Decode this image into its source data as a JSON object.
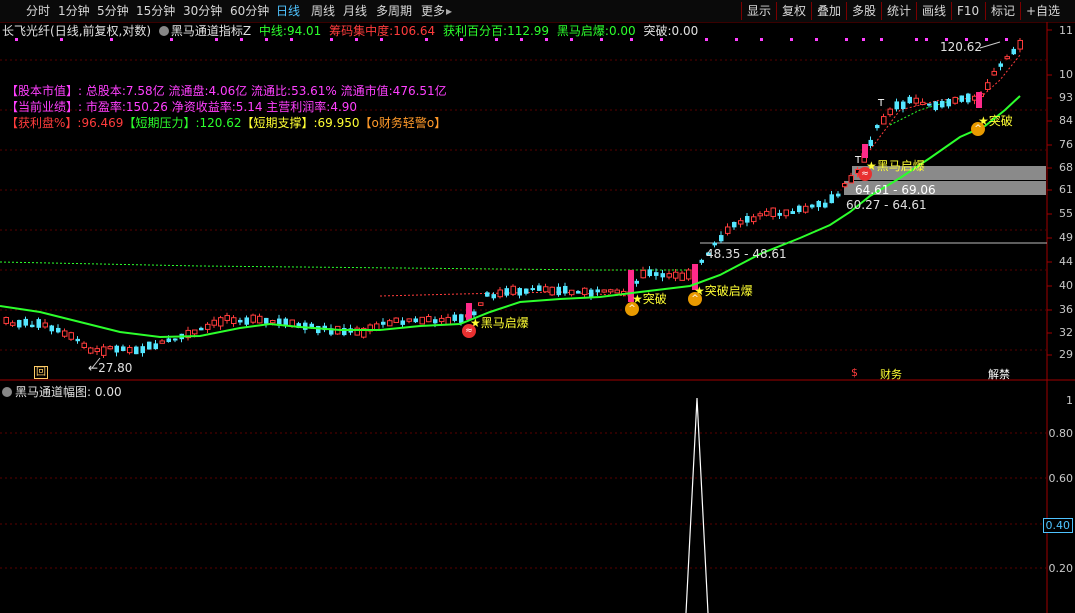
{
  "toolbar": {
    "periods": [
      "分时",
      "1分钟",
      "5分钟",
      "15分钟",
      "30分钟",
      "60分钟",
      "日线",
      "周线",
      "月线",
      "多周期",
      "更多"
    ],
    "active_period": "日线",
    "more_arrow": "▸",
    "tools": [
      "显示",
      "复权",
      "叠加",
      "多股",
      "统计",
      "画线",
      "F10",
      "标记",
      "+自选"
    ],
    "scroll_arrow": "◂"
  },
  "title": {
    "stock": "长飞光纤",
    "mode": "(日线,前复权,对数)",
    "indicator": "黑马通道指标Z",
    "mid_label": "中线:",
    "mid_value": "94.01",
    "chip_label": "筹码集中度:",
    "chip_value": "106.64",
    "profit_label": "获利百分百:",
    "profit_value": "112.99",
    "horse_label": "黑马启爆:",
    "horse_value": "0.00",
    "break_label": "突破:",
    "break_value": "0.00"
  },
  "info": {
    "l1_tag": "【股本市值】:",
    "l1_text": "总股本:7.58亿 流通盘:4.06亿 流通比:53.61% 流通市值:476.51亿",
    "l2_tag": "【当前业绩】:",
    "l2_text": "市盈率:150.26 净资收益率:5.14 主营利润率:4.90",
    "l3_a": "【获利盘%】:96.469",
    "l3_b": "【短期压力】:120.62",
    "l3_c": "【短期支撑】:69.950",
    "l3_d": "【o财务轻警o】"
  },
  "y_axis": [
    "11",
    "10",
    "93",
    "84",
    "76",
    "68",
    "61",
    "55",
    "49",
    "44",
    "40",
    "36",
    "32",
    "29"
  ],
  "annotations": {
    "high": "120.62",
    "low": "27.80",
    "range1": "64.61 - 69.06",
    "range2": "60.27 - 64.61",
    "range3": "48.35 - 48.61"
  },
  "signals": {
    "horse": "黑马启爆",
    "break": "突破",
    "mixed": "突破启爆",
    "t_mark": "T"
  },
  "bottom_markers": {
    "m1": "回",
    "m2": "$",
    "m3": "财务",
    "m4": "解禁"
  },
  "sub_panel": {
    "title": "黑马通道幅图",
    "value_label": ": 0.00",
    "y_labels": [
      "1",
      "0.80",
      "0.60",
      "0.40",
      "0.20"
    ],
    "current": "0.40"
  },
  "colors": {
    "up": "#ff3c3c",
    "down": "#55e6ff",
    "ma": "#2cff2c",
    "accent": "#ff2a8a",
    "yellow": "#ffff33",
    "magenta": "#ff40ff"
  },
  "chart_data": {
    "type": "line",
    "title": "",
    "xlabel": "",
    "ylabel": "",
    "scale": "log",
    "ylim": [
      27,
      125
    ],
    "series": [
      {
        "values": [
          28,
          30,
          31,
          33,
          34,
          35,
          37,
          37,
          38,
          40,
          42,
          44,
          48,
          55,
          62,
          70,
          82,
          90,
          96,
          104
        ]
      },
      {
        "values": [
          32,
          33,
          33,
          34,
          35,
          37,
          39,
          41,
          44,
          48,
          55,
          62,
          68,
          74,
          80,
          86,
          90,
          93,
          97,
          105,
          110,
          118,
          121
        ]
      }
    ]
  }
}
